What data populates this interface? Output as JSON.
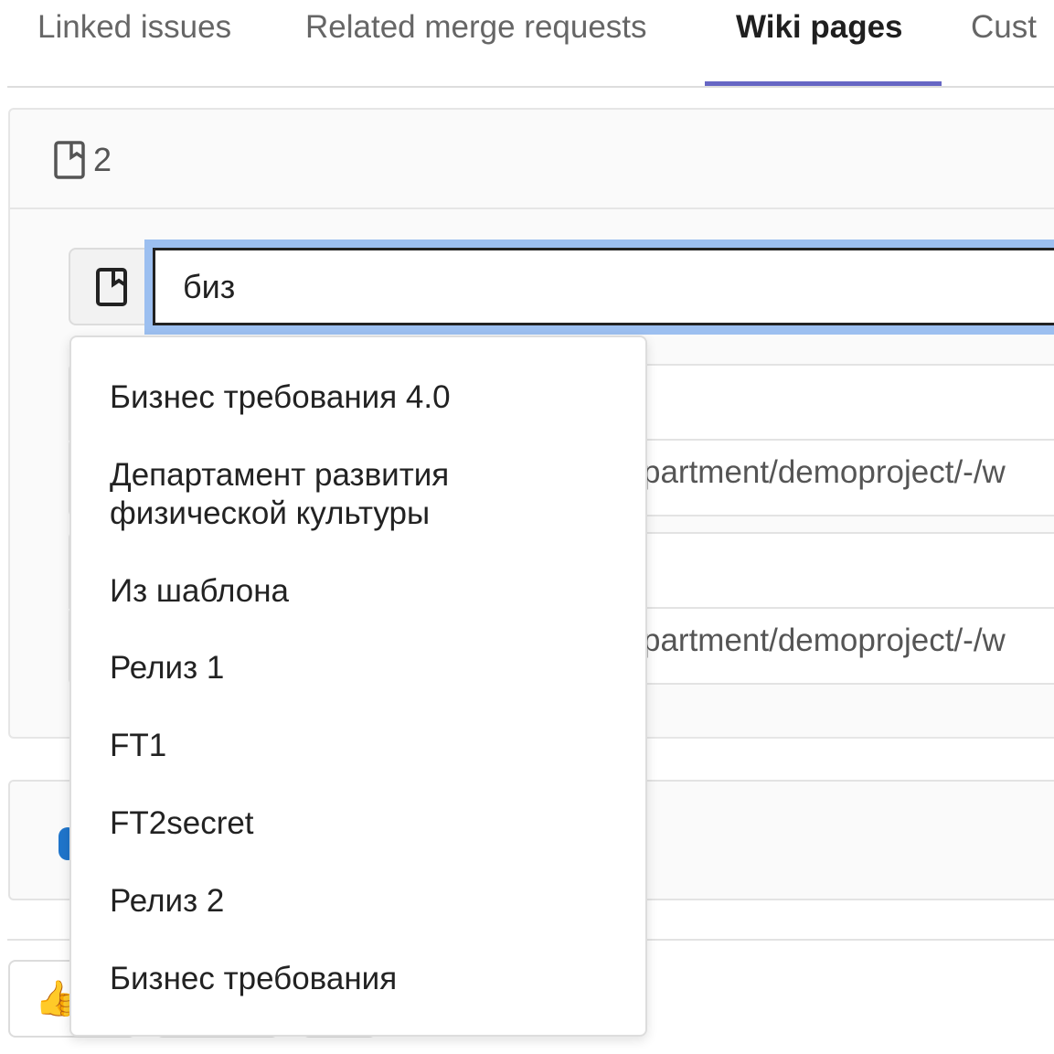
{
  "tabs": [
    {
      "label": "Linked issues"
    },
    {
      "label": "Related merge requests"
    },
    {
      "label": "Wiki pages",
      "active": true
    },
    {
      "label": "Cust"
    }
  ],
  "panel": {
    "count_icon": "wiki-page-icon",
    "count": "2"
  },
  "search": {
    "icon": "wiki-page-icon",
    "value": "биз"
  },
  "linked_pages": [
    {
      "url_fragment": "partment/demoproject/-/w"
    },
    {
      "url_fragment": "partment/demoproject/-/w"
    }
  ],
  "awards": {
    "icon": "thumbs-up-icon",
    "emoji": "👍"
  },
  "dropdown": {
    "items": [
      "Бизнес требования 4.0",
      "Департамент развития физической культуры",
      "Из шаблона",
      "Релиз 1",
      "FT1",
      "FT2secret",
      "Релиз 2",
      "Бизнес требования"
    ]
  },
  "colors": {
    "tab_underline": "#6666c4",
    "focus_ring": "#9cbff0",
    "accent_blue": "#1f75cb"
  }
}
